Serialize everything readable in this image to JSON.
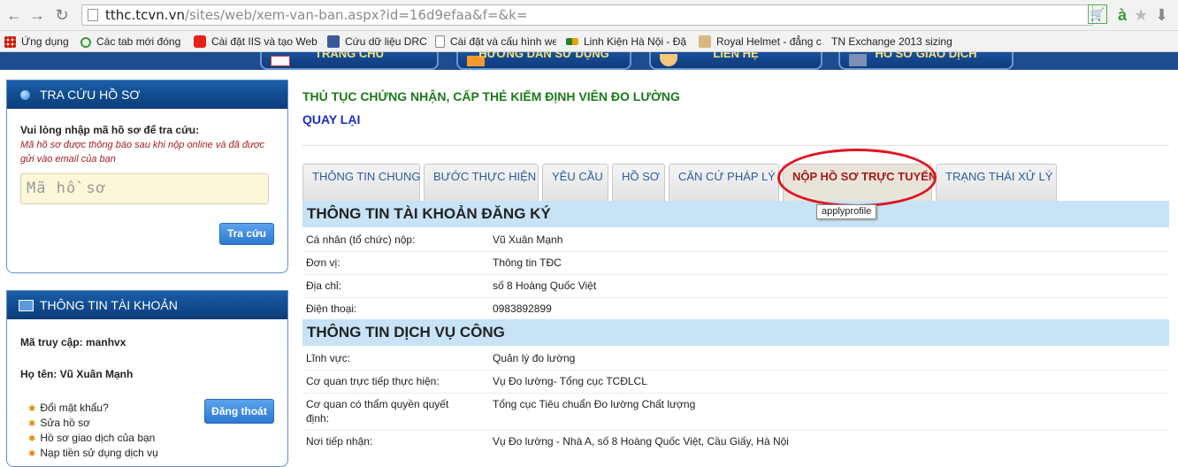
{
  "browser": {
    "url_host": "tthc.tcvn.vn",
    "url_path": "/sites/web/xem-van-ban.aspx?id=16d9efaa&f=&k=",
    "bookmarks": [
      {
        "label": "Ứng dụng",
        "icon": "apps-grid-icon",
        "color": "#e0492f"
      },
      {
        "label": "Các tab mới đóng",
        "icon": "history-icon",
        "color": "#3a9a3a"
      },
      {
        "label": "Cài đặt IIS và tạo Web",
        "icon": "youtube-icon",
        "color": "#e62117"
      },
      {
        "label": "Cứu dữ liệu DRC",
        "icon": "facebook-icon",
        "color": "#3b5998"
      },
      {
        "label": "Cài đặt và cấu hình we",
        "icon": "page-icon",
        "color": "#888888"
      },
      {
        "label": "Linh Kiện Hà Nội - Đặ",
        "icon": "dp-icon",
        "color": "#e2a800"
      },
      {
        "label": "Royal Helmet - đẳng c",
        "icon": "crown-icon",
        "color": "#c79a55"
      },
      {
        "label": "TN Exchange 2013 sizing",
        "icon": "blank-icon",
        "color": "#f2f2f2"
      }
    ]
  },
  "site_nav": [
    "TRANG CHỦ",
    "HƯỚNG DẪN SỬ DỤNG",
    "LIÊN HỆ",
    "HỒ SƠ GIAO DỊCH"
  ],
  "lookup": {
    "heading": "TRA CỨU HỒ SƠ",
    "prompt": "Vui lòng nhập mã hồ sơ để tra cứu:",
    "note": "Mã hồ sơ được thông báo sau khi nộp online và đã được gửi vào email của bạn",
    "placeholder": "Mã hồ sơ",
    "button": "Tra cứu"
  },
  "account": {
    "heading": "THÔNG TIN TÀI KHOẢN",
    "access_code": "Mã truy cập: manhvx",
    "full_name": "Họ tên: Vũ Xuân Mạnh",
    "links": [
      "Đổi mật khẩu?",
      "Sửa hồ sơ",
      "Hồ sơ giao dịch của bạn",
      "Nạp tiền sử dụng dịch vụ"
    ],
    "logout": "Đăng thoát"
  },
  "main": {
    "title": "THỦ TỤC CHỨNG NHẬN, CẤP THẺ KIỂM ĐỊNH VIÊN ĐO LƯỜNG",
    "back": "QUAY LẠI",
    "tabs": [
      "THÔNG TIN CHUNG",
      "BƯỚC THỰC HIỆN",
      "YÊU CẦU",
      "HỒ SƠ",
      "CĂN CỨ PHÁP LÝ",
      "NỘP HỒ SƠ TRỰC TUYẾN",
      "TRẠNG THÁI XỬ LÝ"
    ],
    "active_tab": "NỘP HỒ SƠ TRỰC TUYẾN",
    "tooltip": "applyprofile",
    "section1": {
      "heading": "THÔNG TIN TÀI KHOẢN ĐĂNG KÝ",
      "rows": [
        {
          "k": "Cá nhân (tổ chức) nộp:",
          "v": "Vũ Xuân Mạnh"
        },
        {
          "k": "Đơn vị:",
          "v": "Thông tin TĐC"
        },
        {
          "k": "Địa chỉ:",
          "v": "số 8 Hoàng Quốc Việt"
        },
        {
          "k": "Điện thoại:",
          "v": "0983892899"
        }
      ]
    },
    "section2": {
      "heading": "THÔNG TIN DỊCH VỤ CÔNG",
      "rows": [
        {
          "k": "Lĩnh vực:",
          "v": "Quản lý đo lường"
        },
        {
          "k": "Cơ quan trực tiếp thực hiện:",
          "v": "Vụ Đo lường- Tổng cục TCĐLCL"
        },
        {
          "k": "Cơ quan có thẩm quyền quyết định:",
          "v": "Tổng cục Tiêu chuẩn Đo lường Chất lượng"
        },
        {
          "k": "Nơi tiếp nhận:",
          "v": "Vụ Đo lường - Nhà A, số 8 Hoàng Quốc Việt, Cầu Giấy, Hà Nội"
        }
      ]
    }
  }
}
